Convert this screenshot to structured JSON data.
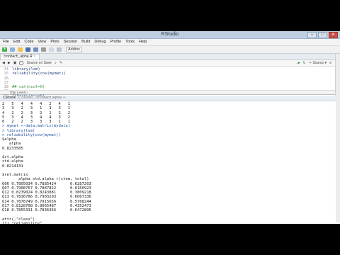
{
  "window": {
    "title": "RStudio",
    "controls": [
      "–",
      "□",
      "✕"
    ]
  },
  "menubar": [
    "File",
    "Edit",
    "Code",
    "View",
    "Plots",
    "Session",
    "Build",
    "Debug",
    "Profile",
    "Tools",
    "Help"
  ],
  "toolbar": {
    "addins_label": "Addins"
  },
  "editor": {
    "tab_label": "cronbach_alpha.R",
    "source_on_save_label": "Source on Save",
    "source_button_label": "Source",
    "lines": [
      {
        "num": "14",
        "text": "library(lsm)"
      },
      {
        "num": "15",
        "text": "reliability(cov(mymat))"
      },
      {
        "num": "16",
        "text": ""
      },
      {
        "num": "17",
        "text": ""
      },
      {
        "num": "18",
        "text": "## cat(ncol=0)",
        "comment": true
      },
      {
        "num": "19",
        "text": ""
      },
      {
        "num": "20",
        "text": "library(psych)"
      },
      {
        "num": "21",
        "text": "alpha(mydata)"
      },
      {
        "num": "22",
        "text": ""
      }
    ],
    "status_text": "(Top Level) ÷"
  },
  "console": {
    "header_title": "Console",
    "header_path": "C:/Users/.../cronbach alpha/ ⇨",
    "lines": [
      {
        "text": "2   5   4   4   4   2   4   1",
        "type": "out"
      },
      {
        "text": "3   3   2   3   1   3   3   1",
        "type": "out"
      },
      {
        "text": "4   2   2   3   2   1   2   2",
        "type": "out"
      },
      {
        "text": "5   3   4   3   4   4   3   2",
        "type": "out"
      },
      {
        "text": "6   2   2   3   3   3   1   1",
        "type": "out"
      },
      {
        "text": "> mymat <-data.matrix(mydata)",
        "type": "cmd"
      },
      {
        "text": "> library(lsm)",
        "type": "cmd"
      },
      {
        "text": "> reliability(cov(mymat))",
        "type": "cmd"
      },
      {
        "text": "$alpha",
        "type": "out"
      },
      {
        "text": "   alpha",
        "type": "out"
      },
      {
        "text": "0.8233585",
        "type": "out"
      },
      {
        "text": "",
        "type": "out"
      },
      {
        "text": "$st.alpha",
        "type": "out"
      },
      {
        "text": "std.alpha",
        "type": "out"
      },
      {
        "text": "0.8214131",
        "type": "out"
      },
      {
        "text": "",
        "type": "out"
      },
      {
        "text": "$rel.matrix",
        "type": "out"
      },
      {
        "text": "       alpha std.alpha r(item, total)",
        "type": "out"
      },
      {
        "text": "Q06 0.7805934 0.7885424      0.6287203",
        "type": "out"
      },
      {
        "text": "Q07 0.7908767 0.7887822      0.6160923",
        "type": "out"
      },
      {
        "text": "Q12 0.8239024 0.8243881      0.3809218",
        "type": "out"
      },
      {
        "text": "Q13 0.7836786 0.7903203      0.6067336",
        "type": "out"
      },
      {
        "text": "Q14 0.7878749 0.7915656      0.5768244",
        "type": "out"
      },
      {
        "text": "Q17 0.8128708 0.8065487      0.4352473",
        "type": "out"
      },
      {
        "text": "Q18 0.7855331 0.7836366      0.6472895",
        "type": "out"
      },
      {
        "text": "",
        "type": "out"
      },
      {
        "text": "attr(,\"class\")",
        "type": "out"
      },
      {
        "text": "[1] \"reliability\"",
        "type": "out"
      },
      {
        "text": ">",
        "type": "cmd"
      }
    ]
  }
}
